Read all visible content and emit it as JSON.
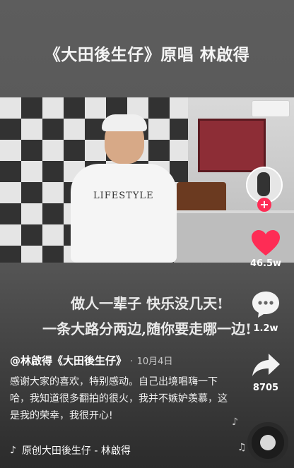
{
  "overlay_title": "《大田後生仔》原唱 林啟得",
  "video": {
    "shirt_print": "LIFESTYLE"
  },
  "lyrics": {
    "line1": "做人一辈子 快乐没几天!",
    "line2": "一条大路分两边,随你要走哪一边!"
  },
  "post": {
    "author": "@林啟得《大田後生仔》",
    "separator": "·",
    "date": "10月4日",
    "description": "感谢大家的喜欢，特别感动。自己出境唱嗨一下哈，我知道很多翻拍的很火，我并不嫉妒羡慕，这是我的荣幸，我很开心!"
  },
  "music": {
    "icon": "tiktok-note-icon",
    "label": "原创大田後生仔 - 林啟得"
  },
  "sidebar": {
    "follow_plus": "+",
    "like_count": "46.5w",
    "comment_count": "1.2w",
    "share_count": "8705"
  },
  "colors": {
    "like": "#fe2c55",
    "follow": "#fe2c55"
  }
}
